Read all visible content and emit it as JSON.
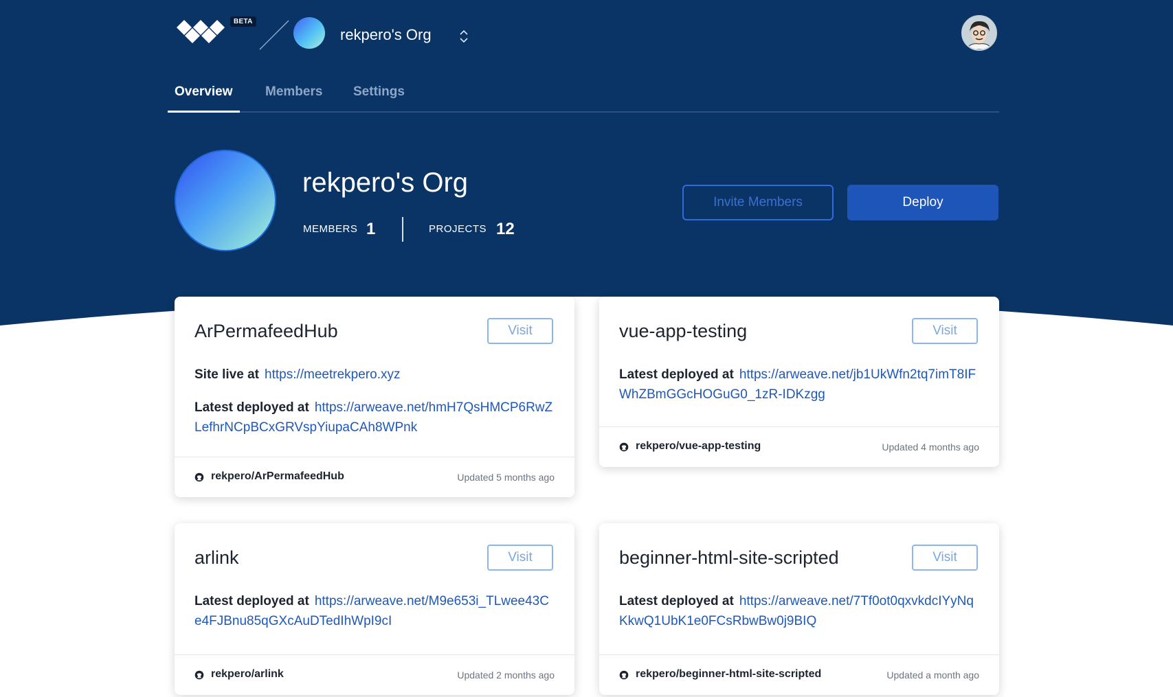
{
  "brand": {
    "badge": "BETA"
  },
  "org": {
    "name": "rekpero's Org"
  },
  "tabs": [
    {
      "label": "Overview",
      "active": true
    },
    {
      "label": "Members",
      "active": false
    },
    {
      "label": "Settings",
      "active": false
    }
  ],
  "stats": {
    "members_label": "MEMBERS",
    "members_value": "1",
    "projects_label": "PROJECTS",
    "projects_value": "12"
  },
  "actions": {
    "invite_label": "Invite Members",
    "deploy_label": "Deploy"
  },
  "projects": [
    {
      "name": "ArPermafeedHub",
      "visit_label": "Visit",
      "site_label": "Site live at",
      "site_url": "https://meetrekpero.xyz",
      "deploy_label": "Latest deployed at",
      "deploy_url": "https://arweave.net/hmH7QsHMCP6RwZLefhrNCpBCxGRVspYiupaCAh8WPnk",
      "repo": "rekpero/ArPermafeedHub",
      "updated": "Updated 5 months ago"
    },
    {
      "name": "vue-app-testing",
      "visit_label": "Visit",
      "deploy_label": "Latest deployed at",
      "deploy_url": "https://arweave.net/jb1UkWfn2tq7imT8IFWhZBmGGcHOGuG0_1zR-IDKzgg",
      "repo": "rekpero/vue-app-testing",
      "updated": "Updated 4 months ago"
    },
    {
      "name": "arlink",
      "visit_label": "Visit",
      "deploy_label": "Latest deployed at",
      "deploy_url": "https://arweave.net/M9e653i_TLwee43Ce4FJBnu85qGXcAuDTedIhWpI9cI",
      "repo": "rekpero/arlink",
      "updated": "Updated 2 months ago"
    },
    {
      "name": "beginner-html-site-scripted",
      "visit_label": "Visit",
      "deploy_label": "Latest deployed at",
      "deploy_url": "https://arweave.net/7Tf0ot0qxvkdcIYyNqKkwQ1UbK1e0FCsRbwBw0j9BIQ",
      "repo": "rekpero/beginner-html-site-scripted",
      "updated": "Updated a month ago"
    }
  ],
  "colors": {
    "header_bg": "#0a3465",
    "accent": "#1e55b8",
    "link": "#1f58b8"
  },
  "icons": [
    "logo-icon",
    "chevron-updown-icon",
    "github-icon",
    "user-avatar"
  ]
}
